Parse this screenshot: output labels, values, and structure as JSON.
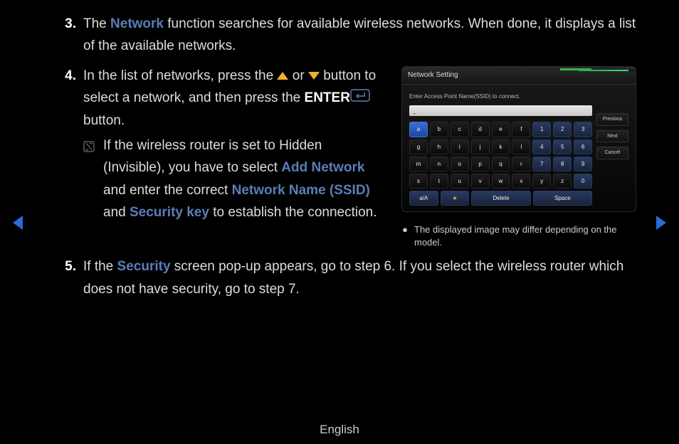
{
  "steps": {
    "s3": {
      "num": "3.",
      "t1": "The ",
      "h1": "Network",
      "t2": " function searches for available wireless networks. When done, it displays a list of the available networks."
    },
    "s4": {
      "num": "4.",
      "t1": "In the list of networks, press the ",
      "t2": " or ",
      "t3": " button to select a network, and then press the ",
      "enter": "ENTER",
      "t4": " button.",
      "note": {
        "t1": "If the wireless router is set to Hidden (Invisible), you have to select ",
        "h1": "Add Network",
        "t2": " and enter the correct ",
        "h2": "Network Name (SSID)",
        "t3": " and ",
        "h3": "Security key",
        "t4": " to establish the connection."
      }
    },
    "s5": {
      "num": "5.",
      "t1": "If the ",
      "h1": "Security",
      "t2": " screen pop-up appears, go to step 6. If you select the wireless router which does not have security, go to step 7."
    }
  },
  "osd": {
    "title": "Network Setting",
    "prompt": "Enter Access Point Name(SSID) to connect.",
    "input_placeholder": "_",
    "side": {
      "prev": "Previous",
      "next": "Next",
      "cancel": "Cancel"
    },
    "keys_letters": [
      "a",
      "b",
      "c",
      "d",
      "e",
      "f",
      "g",
      "h",
      "i",
      "j",
      "k",
      "l",
      "m",
      "n",
      "o",
      "p",
      "q",
      "r",
      "s",
      "t",
      "u",
      "v",
      "w",
      "x",
      "y",
      "z"
    ],
    "keys_nums": [
      "1",
      "2",
      "3",
      "4",
      "5",
      "6",
      "7",
      "8",
      "9",
      "0"
    ],
    "bottom": {
      "case": "a/A",
      "star": "★",
      "delete": "Delete",
      "space": "Space"
    }
  },
  "caption": "The displayed image may differ depending on the model.",
  "footer": "English"
}
